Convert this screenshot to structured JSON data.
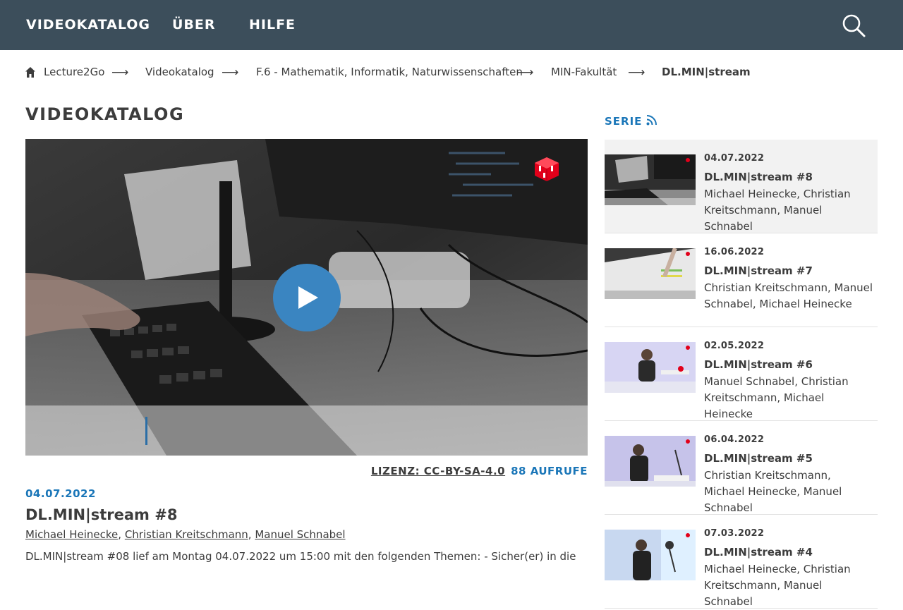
{
  "nav": {
    "items": [
      "VIDEOKATALOG",
      "ÜBER",
      "HILFE"
    ]
  },
  "breadcrumb": {
    "home": "Lecture2Go",
    "items": [
      "Videokatalog",
      "F.6 - Mathematik, Informatik, Naturwissenschaften",
      "MIN-Fakultät"
    ],
    "current": "DL.MIN|stream",
    "separator": "⟶"
  },
  "page": {
    "title": "VIDEOKATALOG"
  },
  "video": {
    "license": "LIZENZ: CC-BY-SA-4.0",
    "views": "88 AUFRUFE",
    "date": "04.07.2022",
    "title": "DL.MIN|stream #8",
    "authors": [
      "Michael Heinecke",
      "Christian Kreitschmann",
      "Manuel Schnabel"
    ],
    "author_sep": ", ",
    "description": "DL.MIN|stream #08 lief am Montag 04.07.2022 um 15:00 mit den folgenden Themen: - Sicher(er) in die"
  },
  "series": {
    "heading": "SERIE",
    "items": [
      {
        "date": "04.07.2022",
        "title": "DL.MIN|stream #8",
        "authors": "Michael Heinecke, Christian Kreitschmann, Manuel Schnabel"
      },
      {
        "date": "16.06.2022",
        "title": "DL.MIN|stream #7",
        "authors": "Christian Kreitschmann, Manuel Schnabel, Michael Heinecke"
      },
      {
        "date": "02.05.2022",
        "title": "DL.MIN|stream #6",
        "authors": "Manuel Schnabel, Christian Kreitschmann, Michael Heinecke"
      },
      {
        "date": "06.04.2022",
        "title": "DL.MIN|stream #5",
        "authors": "Christian Kreitschmann, Michael Heinecke, Manuel Schnabel"
      },
      {
        "date": "07.03.2022",
        "title": "DL.MIN|stream #4",
        "authors": "Michael Heinecke, Christian Kreitschmann, Manuel Schnabel"
      }
    ]
  },
  "colors": {
    "topbar": "#3c4e5b",
    "accent": "#1a76b8",
    "play": "#3a85c1"
  }
}
